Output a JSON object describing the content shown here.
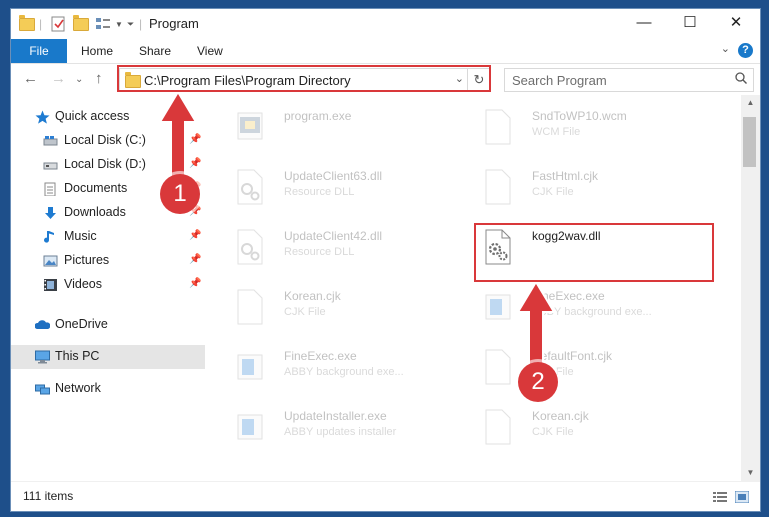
{
  "window": {
    "title": "Program"
  },
  "ribbon": {
    "file": "File",
    "tabs": [
      "Home",
      "Share",
      "View"
    ],
    "help": "?"
  },
  "address": {
    "path": "C:\\Program Files\\Program Directory"
  },
  "search": {
    "placeholder": "Search Program"
  },
  "sidebar": {
    "items": [
      {
        "label": "Quick access",
        "icon": "star-icon"
      },
      {
        "label": "Local Disk (C:)",
        "icon": "drive-icon",
        "pinned": true
      },
      {
        "label": "Local Disk (D:)",
        "icon": "drive-icon",
        "pinned": true
      },
      {
        "label": "Documents",
        "icon": "documents-icon",
        "pinned": true
      },
      {
        "label": "Downloads",
        "icon": "downloads-icon",
        "pinned": true
      },
      {
        "label": "Music",
        "icon": "music-icon",
        "pinned": true
      },
      {
        "label": "Pictures",
        "icon": "pictures-icon",
        "pinned": true
      },
      {
        "label": "Videos",
        "icon": "videos-icon",
        "pinned": true
      },
      {
        "label": "OneDrive",
        "icon": "onedrive-icon"
      },
      {
        "label": "This PC",
        "icon": "pc-icon",
        "selected": true
      },
      {
        "label": "Network",
        "icon": "network-icon"
      }
    ]
  },
  "files": {
    "left": [
      {
        "name": "program.exe",
        "desc": ""
      },
      {
        "name": "UpdateClient63.dll",
        "desc": "Resource DLL"
      },
      {
        "name": "UpdateClient42.dll",
        "desc": "Resource DLL"
      },
      {
        "name": "Korean.cjk",
        "desc": "CJK File"
      },
      {
        "name": "FineExec.exe",
        "desc": "ABBY background exe..."
      },
      {
        "name": "UpdateInstaller.exe",
        "desc": "ABBY updates installer"
      }
    ],
    "right": [
      {
        "name": "SndToWP10.wcm",
        "desc": "WCM File"
      },
      {
        "name": "FastHtml.cjk",
        "desc": "CJK File"
      },
      {
        "name": "kogg2wav.dll",
        "desc": ""
      },
      {
        "name": "FineExec.exe",
        "desc": "ABBY background exe..."
      },
      {
        "name": "DefaultFont.cjk",
        "desc": "CJK File"
      },
      {
        "name": "Korean.cjk",
        "desc": "CJK File"
      }
    ]
  },
  "status": {
    "items": "111 items"
  },
  "annotations": {
    "step1": "1",
    "step2": "2",
    "color": "#d9383a"
  }
}
